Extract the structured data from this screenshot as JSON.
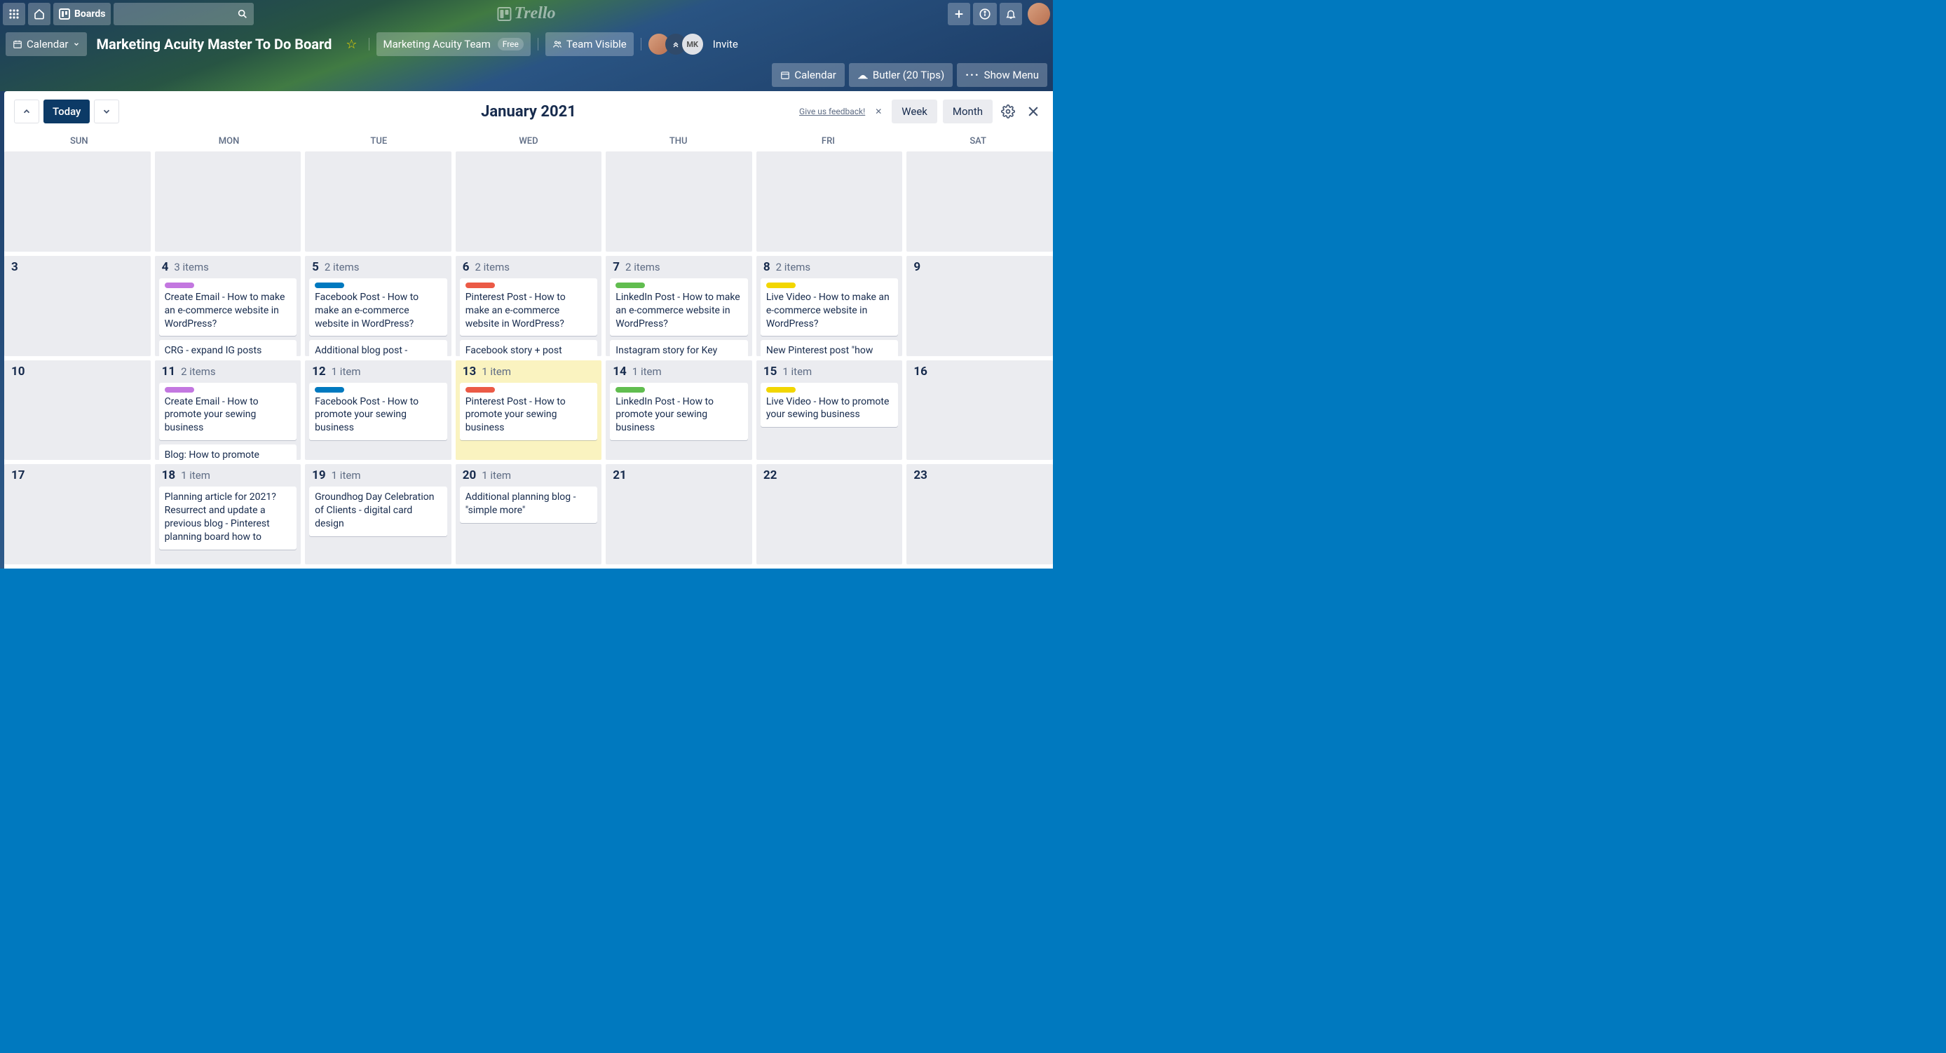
{
  "topnav": {
    "boards_label": "Boards",
    "logo_text": "Trello"
  },
  "board_header": {
    "view_switch_label": "Calendar",
    "title": "Marketing Acuity Master To Do Board",
    "team_label": "Marketing Acuity Team",
    "team_badge": "Free",
    "visibility_label": "Team Visible",
    "member3_initials": "MK",
    "invite_label": "Invite"
  },
  "secondary": {
    "calendar_label": "Calendar",
    "butler_label": "Butler (20 Tips)",
    "show_menu_label": "Show Menu"
  },
  "calendar": {
    "today_label": "Today",
    "title": "January 2021",
    "feedback_label": "Give us feedback!",
    "week_label": "Week",
    "month_label": "Month",
    "dow": [
      "SUN",
      "MON",
      "TUE",
      "WED",
      "THU",
      "FRI",
      "SAT"
    ],
    "cells": [
      {
        "day": "",
        "items": "",
        "cards": []
      },
      {
        "day": "",
        "items": "",
        "cards": []
      },
      {
        "day": "",
        "items": "",
        "cards": []
      },
      {
        "day": "",
        "items": "",
        "cards": []
      },
      {
        "day": "",
        "items": "",
        "cards": []
      },
      {
        "day": "",
        "items": "",
        "cards": []
      },
      {
        "day": "",
        "items": "",
        "cards": []
      },
      {
        "day": "3",
        "items": "",
        "cards": []
      },
      {
        "day": "4",
        "items": "3 items",
        "cards": [
          {
            "color": "purple",
            "text": "Create Email - How to make an e-commerce website in WordPress?"
          },
          {
            "color": "",
            "text": "CRG - expand IG posts"
          }
        ]
      },
      {
        "day": "5",
        "items": "2 items",
        "cards": [
          {
            "color": "blue",
            "text": "Facebook Post - How to make an e-commerce website in WordPress?"
          },
          {
            "color": "",
            "text": "Additional blog post -"
          }
        ]
      },
      {
        "day": "6",
        "items": "2 items",
        "cards": [
          {
            "color": "red",
            "text": "Pinterest Post - How to make an e-commerce website in WordPress?"
          },
          {
            "color": "",
            "text": "Facebook story + post"
          }
        ]
      },
      {
        "day": "7",
        "items": "2 items",
        "cards": [
          {
            "color": "green",
            "text": "LinkedIn Post - How to make an e-commerce website in WordPress?"
          },
          {
            "color": "",
            "text": "Instagram story for Key"
          }
        ]
      },
      {
        "day": "8",
        "items": "2 items",
        "cards": [
          {
            "color": "yellow",
            "text": "Live Video - How to make an e-commerce website in WordPress?"
          },
          {
            "color": "",
            "text": "New Pinterest post \"how"
          }
        ]
      },
      {
        "day": "9",
        "items": "",
        "cards": []
      },
      {
        "day": "10",
        "items": "",
        "cards": []
      },
      {
        "day": "11",
        "items": "2 items",
        "cards": [
          {
            "color": "purple",
            "text": "Create Email - How to promote your sewing business"
          },
          {
            "color": "",
            "text": "Blog: How to promote"
          }
        ]
      },
      {
        "day": "12",
        "items": "1 item",
        "cards": [
          {
            "color": "blue",
            "text": "Facebook Post - How to promote your sewing business"
          }
        ]
      },
      {
        "day": "13",
        "items": "1 item",
        "highlight": true,
        "cards": [
          {
            "color": "red",
            "text": "Pinterest Post - How to promote your sewing business"
          }
        ]
      },
      {
        "day": "14",
        "items": "1 item",
        "cards": [
          {
            "color": "green",
            "text": "LinkedIn Post - How to promote your sewing business"
          }
        ]
      },
      {
        "day": "15",
        "items": "1 item",
        "cards": [
          {
            "color": "yellow",
            "text": "Live Video - How to promote your sewing business"
          }
        ]
      },
      {
        "day": "16",
        "items": "",
        "cards": []
      },
      {
        "day": "17",
        "items": "",
        "cards": []
      },
      {
        "day": "18",
        "items": "1 item",
        "cards": [
          {
            "color": "",
            "text": "Planning article for 2021? Resurrect and update a previous blog - Pinterest planning board how to"
          }
        ]
      },
      {
        "day": "19",
        "items": "1 item",
        "cards": [
          {
            "color": "",
            "text": "Groundhog Day Celebration of Clients - digital card design"
          }
        ]
      },
      {
        "day": "20",
        "items": "1 item",
        "cards": [
          {
            "color": "",
            "text": "Additional planning blog - \"simple more\""
          }
        ]
      },
      {
        "day": "21",
        "items": "",
        "cards": []
      },
      {
        "day": "22",
        "items": "",
        "cards": []
      },
      {
        "day": "23",
        "items": "",
        "cards": []
      }
    ]
  }
}
